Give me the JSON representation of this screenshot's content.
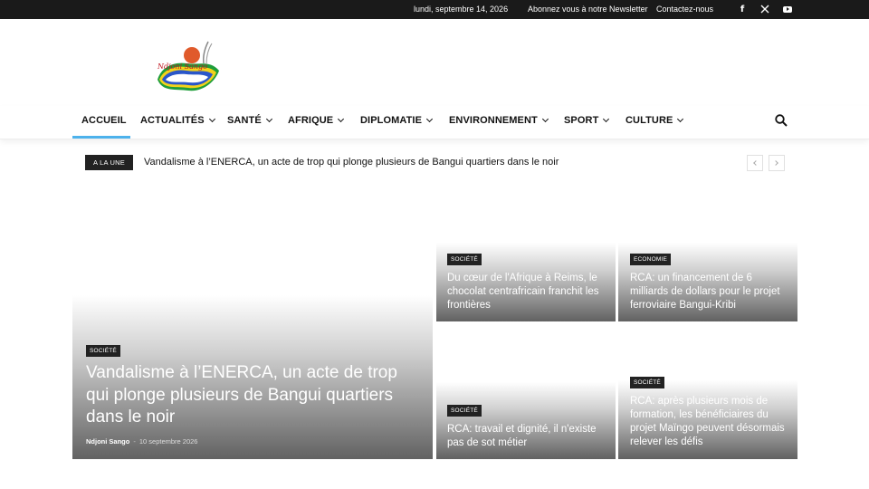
{
  "topbar": {
    "date": "lundi, septembre 14, 2026",
    "newsletter": "Abonnez vous à notre Newsletter",
    "contact": "Contactez-nous",
    "social": [
      "facebook-icon",
      "x-icon",
      "youtube-icon"
    ]
  },
  "logo": {
    "text": "Ndjoni Sango"
  },
  "nav": {
    "items": [
      {
        "label": "ACCUEIL",
        "dropdown": false,
        "active": true
      },
      {
        "label": "ACTUALITÉS",
        "dropdown": true
      },
      {
        "label": "SANTÉ",
        "dropdown": true
      },
      {
        "label": "AFRIQUE",
        "dropdown": true
      },
      {
        "label": "DIPLOMATIE",
        "dropdown": true
      },
      {
        "label": "ENVIRONNEMENT",
        "dropdown": true
      },
      {
        "label": "SPORT",
        "dropdown": true
      },
      {
        "label": "CULTURE",
        "dropdown": true
      }
    ],
    "accent": "#4db2ec"
  },
  "ticker": {
    "badge": "A LA UNE",
    "headline": "Vandalisme à l’ENERCA, un acte de trop qui plonge plusieurs de Bangui quartiers dans le noir"
  },
  "featured": {
    "category": "SOCIÉTÉ",
    "title": "Vandalisme à l’ENERCA, un acte de trop qui plonge plusieurs de Bangui quartiers dans le noir",
    "author": "Ndjoni Sango",
    "separator": "-",
    "date": "10 septembre 2026"
  },
  "cards": [
    {
      "category": "SOCIÉTÉ",
      "title": "Du cœur de l'Afrique à Reims, le chocolat centrafricain franchit les frontières"
    },
    {
      "category": "ECONOMIE",
      "title": "RCA: un financement de 6 milliards de dollars pour le projet ferroviaire Bangui-Kribi"
    },
    {
      "category": "SOCIÉTÉ",
      "title": "RCA: travail et dignité, il n'existe pas de sot métier"
    },
    {
      "category": "SOCIÉTÉ",
      "title": "RCA: après plusieurs mois de formation, les bénéficiaires du projet Maïngo peuvent désormais relever les défis"
    }
  ]
}
